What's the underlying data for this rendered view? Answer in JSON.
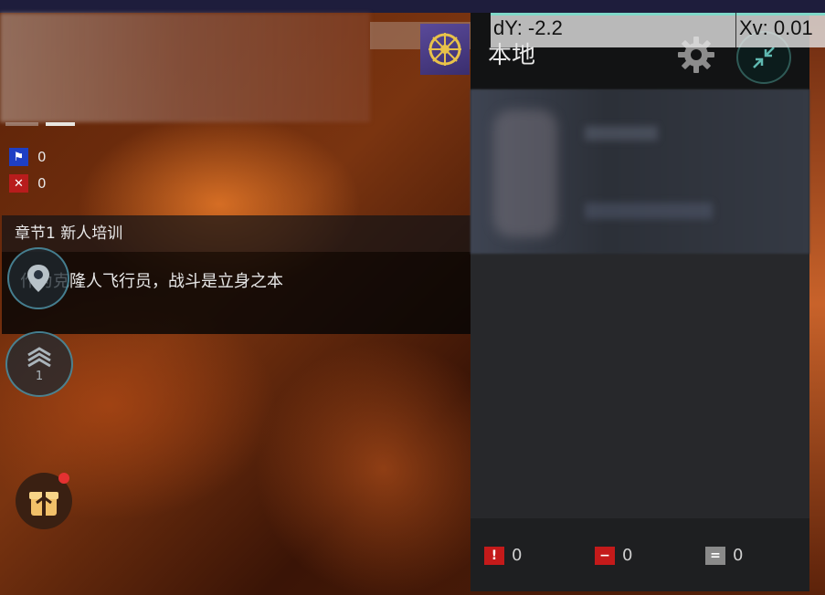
{
  "colors": {
    "accent_teal": "#7fd8c8",
    "flag_blue": "#1e3fc4",
    "flag_red": "#b81c1c",
    "notification_dot": "#e53131"
  },
  "status_flags": [
    {
      "icon": "blue-flag-icon",
      "count": "0"
    },
    {
      "icon": "red-x-icon",
      "count": "0"
    }
  ],
  "mission": {
    "chapter": "章节1 新人培训",
    "description": "作为克隆人飞行员，战斗是立身之本"
  },
  "stack_button": {
    "level": "1"
  },
  "chat": {
    "title": "本地",
    "filters": [
      {
        "icon": "exclamation-icon",
        "count": "0",
        "color": "#c41a1a"
      },
      {
        "icon": "minus-icon",
        "count": "0",
        "color": "#c41a1a"
      },
      {
        "icon": "equals-icon",
        "count": "0",
        "color": "#8a8a8a"
      }
    ]
  },
  "debug": {
    "dy": "dY: -2.2",
    "xv": "Xv: 0.01"
  }
}
